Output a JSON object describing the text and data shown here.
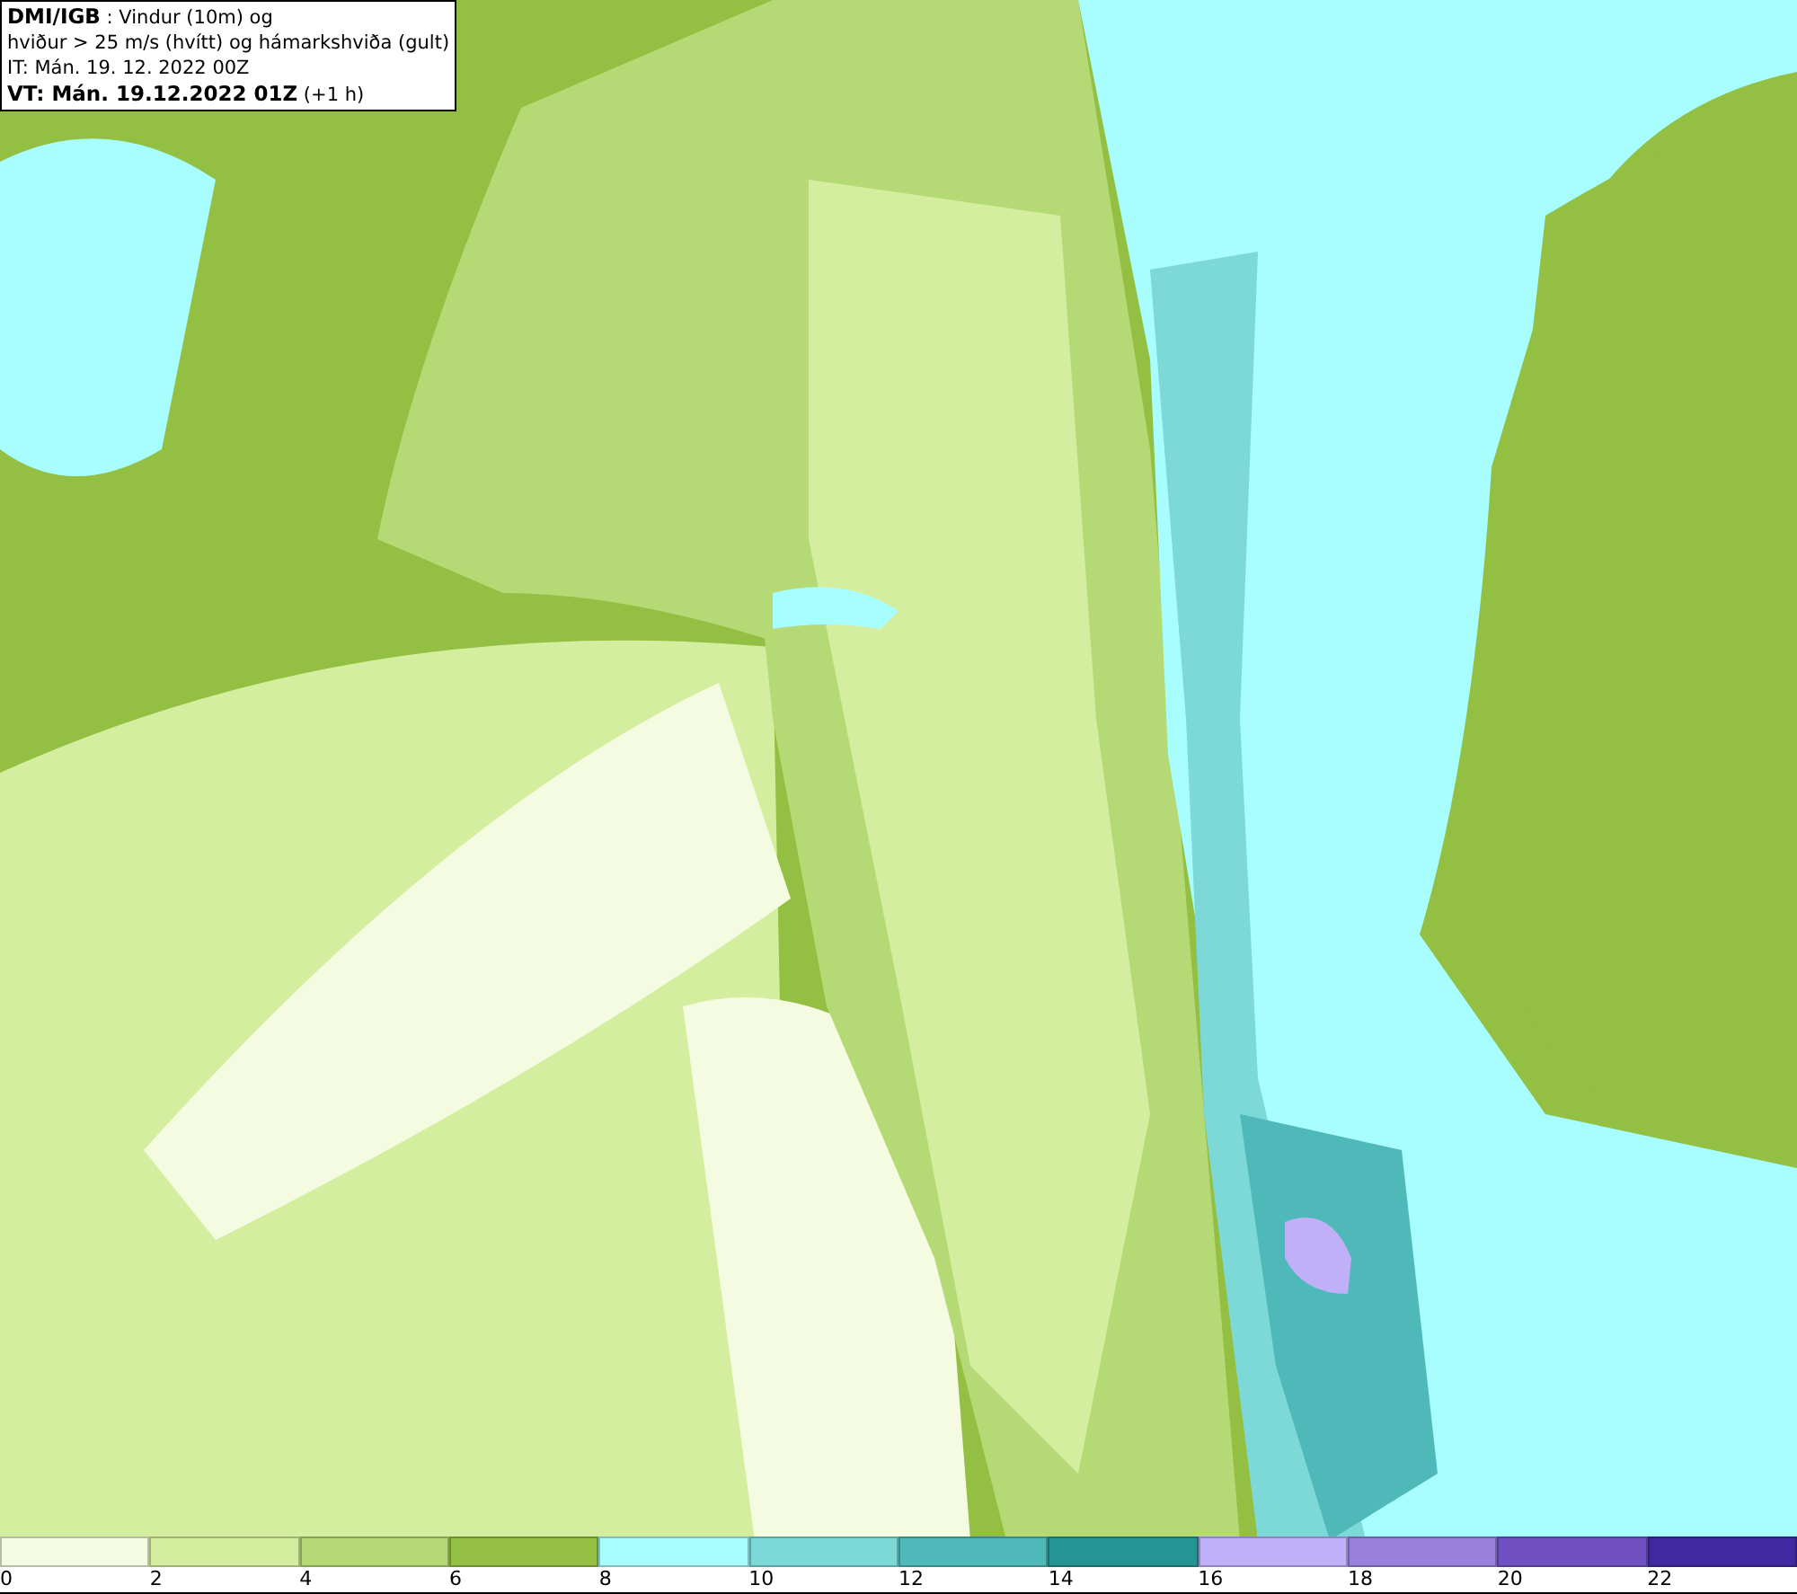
{
  "title_box": {
    "lines": [
      "**DMI/IGB** : Vindur (10m) og",
      "hviður > 25 m/s (hvítt) og hámarkshviða (gult)",
      "IT: Mán. 19. 12. 2022 00Z",
      "**VT: Mán. 19.12.2022 01Z** (+1 h)"
    ]
  },
  "legend": [
    {
      "label": "0",
      "color": "#f5fbe0"
    },
    {
      "label": "2",
      "color": "#d4ee9f"
    },
    {
      "label": "4",
      "color": "#b5d975"
    },
    {
      "label": "6",
      "color": "#93bf42"
    },
    {
      "label": "8",
      "color": "#a8fefe"
    },
    {
      "label": "10",
      "color": "#7dd8d8"
    },
    {
      "label": "12",
      "color": "#4fb8b8"
    },
    {
      "label": "14",
      "color": "#249592"
    },
    {
      "label": "16",
      "color": "#c0b0f8"
    },
    {
      "label": "18",
      "color": "#9880dc"
    },
    {
      "label": "20",
      "color": "#7050c0"
    },
    {
      "label": "22",
      "color": "#4028a0"
    }
  ]
}
